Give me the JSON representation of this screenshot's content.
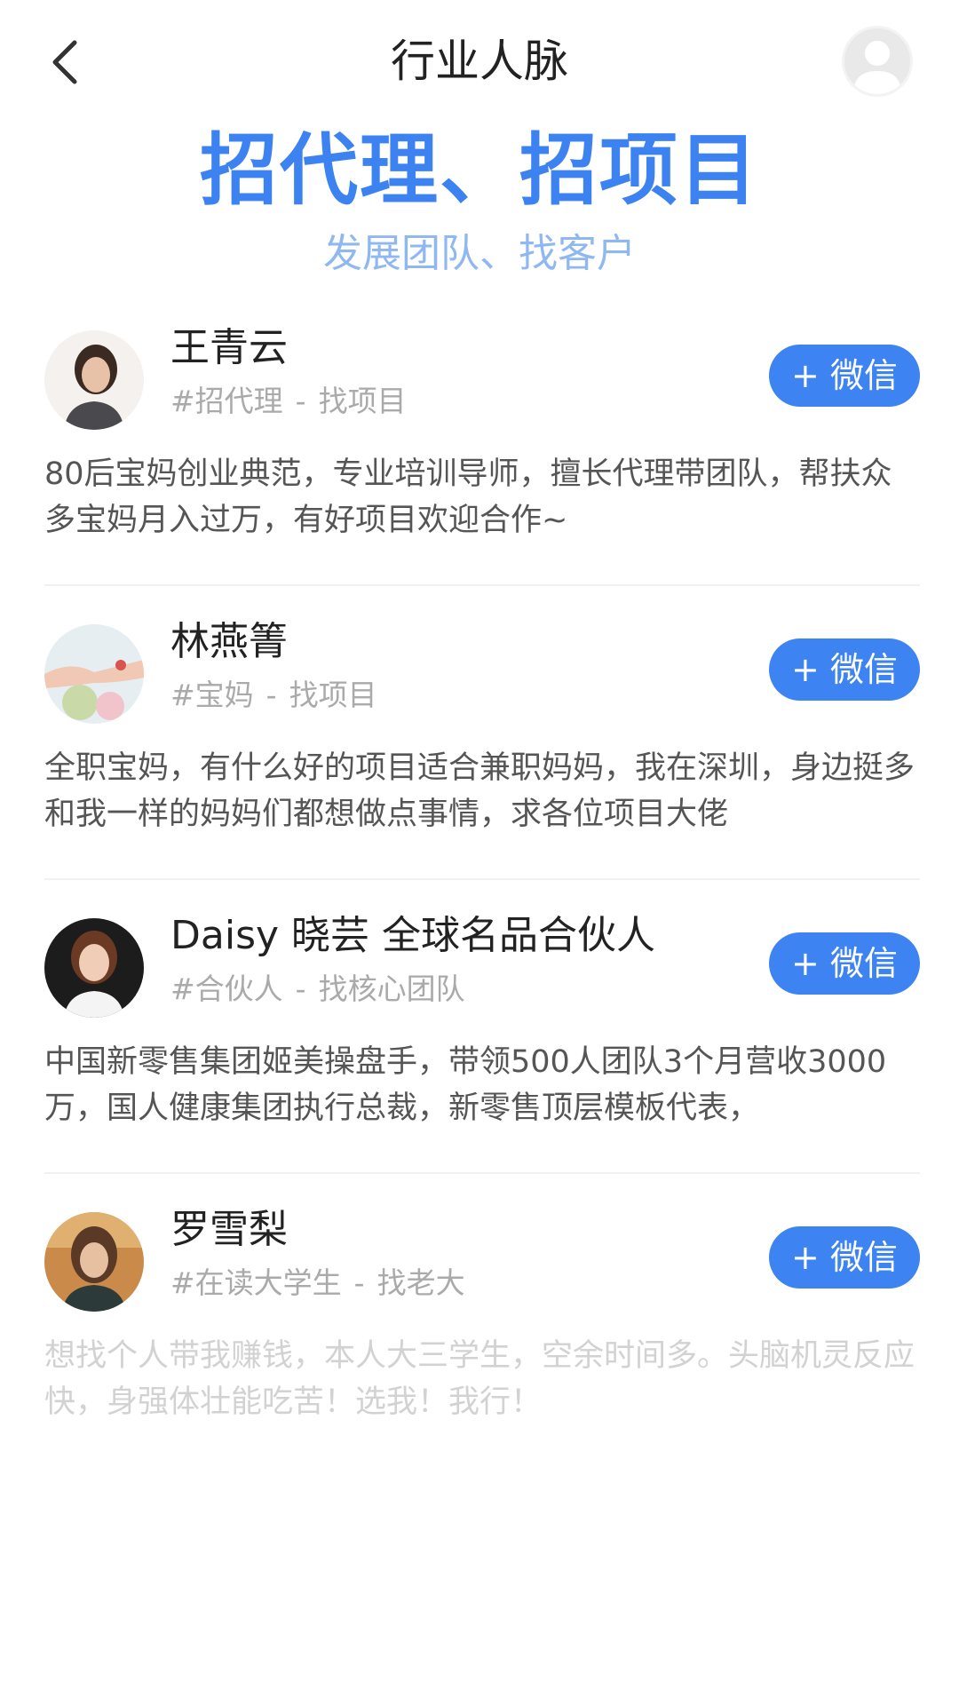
{
  "header": {
    "title": "行业人脉",
    "back_icon": "chevron-left-icon",
    "profile_icon": "user-avatar-icon"
  },
  "hero": {
    "title": "招代理、招项目",
    "subtitle": "发展团队、找客户"
  },
  "colors": {
    "accent": "#3d83f2",
    "accent_light": "#8fb8f3"
  },
  "contacts": [
    {
      "name": "王青云",
      "tag": "#招代理",
      "seek": "找项目",
      "button": "+ 微信",
      "bio": "80后宝妈创业典范，专业培训导师，擅长代理带团队，帮扶众多宝妈月入过万，有好项目欢迎合作~"
    },
    {
      "name": "林燕箐",
      "tag": "#宝妈",
      "seek": "找项目",
      "button": "+ 微信",
      "bio": "全职宝妈，有什么好的项目适合兼职妈妈，我在深圳，身边挺多和我一样的妈妈们都想做点事情，求各位项目大佬"
    },
    {
      "name": "Daisy 晓芸  全球名品合伙人",
      "tag": "#合伙人",
      "seek": "找核心团队",
      "button": "+ 微信",
      "bio": "中国新零售集团姬美操盘手，带领500人团队3个月营收3000万，国人健康集团执行总裁，新零售顶层模板代表，"
    },
    {
      "name": "罗雪梨",
      "tag": "#在读大学生",
      "seek": "找老大",
      "button": "+ 微信",
      "bio": "想找个人带我赚钱，本人大三学生，空余时间多。头脑机灵反应快，身强体壮能吃苦！选我！我行！"
    }
  ]
}
